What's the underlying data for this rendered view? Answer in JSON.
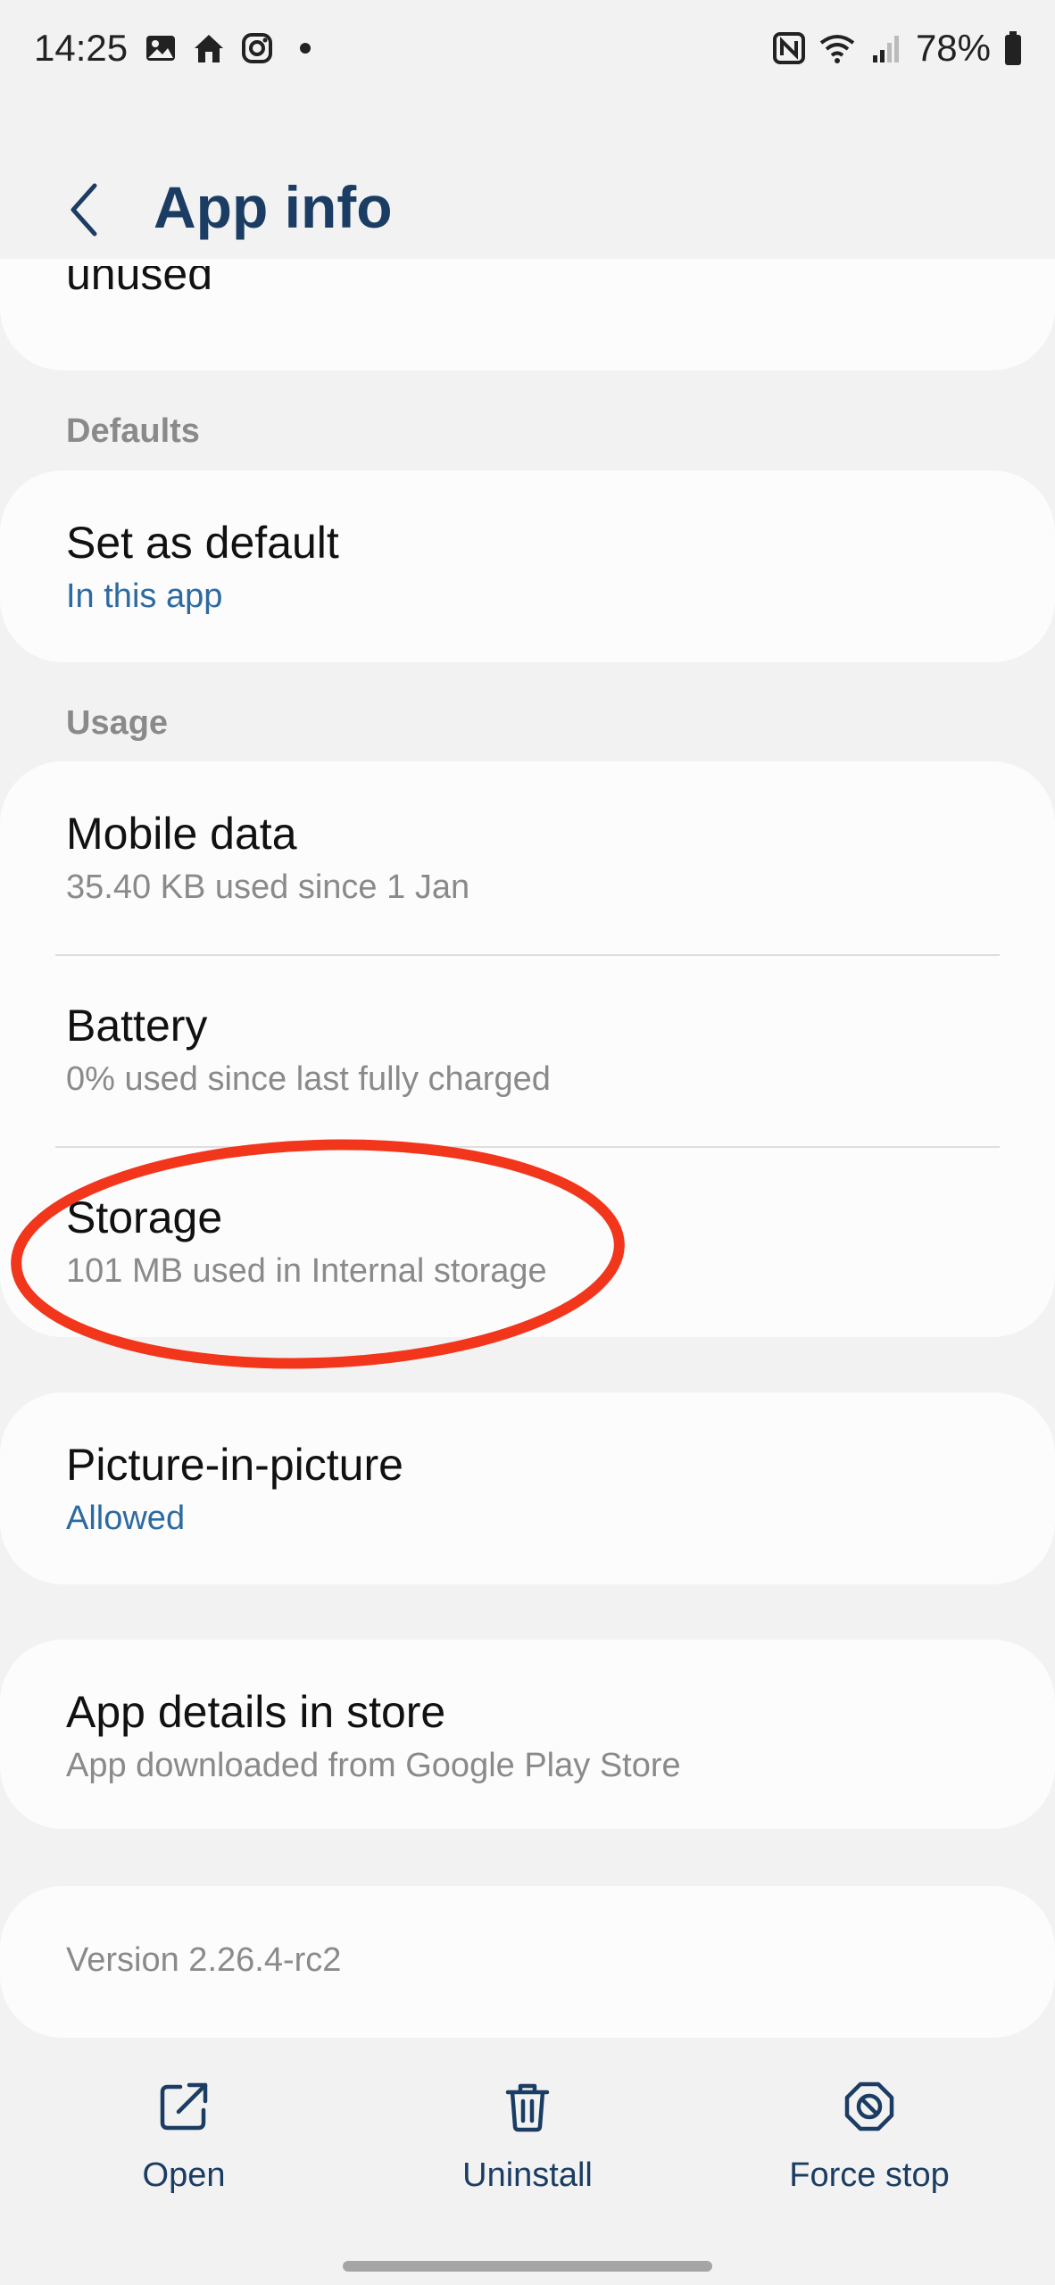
{
  "status_bar": {
    "time": "14:25",
    "battery": "78%",
    "icons_left": [
      "gallery-icon",
      "home-app-icon",
      "instagram-icon",
      "dot-icon"
    ],
    "icons_right": [
      "nfc-icon",
      "wifi-icon",
      "signal-icon",
      "battery-icon"
    ]
  },
  "header": {
    "title": "App info"
  },
  "top_card": {
    "partial_text": "unused"
  },
  "defaults": {
    "section_label": "Defaults",
    "items": [
      {
        "title": "Set as default",
        "subtitle": "In this app"
      }
    ]
  },
  "usage": {
    "section_label": "Usage",
    "items": [
      {
        "title": "Mobile data",
        "subtitle": "35.40 KB used since 1 Jan"
      },
      {
        "title": "Battery",
        "subtitle": "0% used since last fully charged"
      },
      {
        "title": "Storage",
        "subtitle": "101 MB used in Internal storage"
      }
    ]
  },
  "pip": {
    "title": "Picture-in-picture",
    "subtitle": "Allowed"
  },
  "store": {
    "title": "App details in store",
    "subtitle": "App downloaded from Google Play Store"
  },
  "version": {
    "text": "Version 2.26.4-rc2"
  },
  "actions": [
    {
      "label": "Open",
      "icon": "open-external-icon"
    },
    {
      "label": "Uninstall",
      "icon": "trash-icon"
    },
    {
      "label": "Force stop",
      "icon": "stop-icon"
    }
  ],
  "colors": {
    "accent": "#2d6aa0",
    "title_blue": "#1c3d63",
    "annotation_red": "#f2361c",
    "background": "#f2f2f2"
  }
}
